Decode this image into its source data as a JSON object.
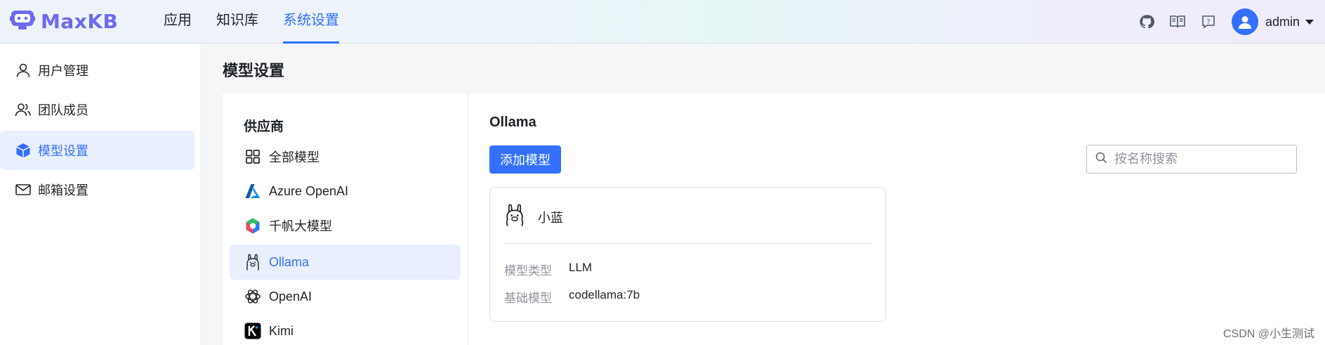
{
  "brand": {
    "name": "MaxKB",
    "color": "#6e6af0"
  },
  "topnav": [
    {
      "label": "应用",
      "active": false
    },
    {
      "label": "知识库",
      "active": false
    },
    {
      "label": "系统设置",
      "active": true
    }
  ],
  "header_right": {
    "icons": [
      "github-icon",
      "docs-book-icon",
      "help-icon"
    ],
    "user": "admin"
  },
  "sidebar": {
    "items": [
      {
        "label": "用户管理",
        "icon": "user-icon",
        "active": false
      },
      {
        "label": "团队成员",
        "icon": "team-icon",
        "active": false
      },
      {
        "label": "模型设置",
        "icon": "cube-icon",
        "active": true
      },
      {
        "label": "邮箱设置",
        "icon": "mail-icon",
        "active": false
      }
    ]
  },
  "page": {
    "title": "模型设置"
  },
  "providers": {
    "title": "供应商",
    "items": [
      {
        "label": "全部模型",
        "icon": "grid-icon",
        "active": false
      },
      {
        "label": "Azure OpenAI",
        "icon": "azure-icon",
        "active": false
      },
      {
        "label": "千帆大模型",
        "icon": "qianfan-icon",
        "active": false
      },
      {
        "label": "Ollama",
        "icon": "ollama-icon",
        "active": true
      },
      {
        "label": "OpenAI",
        "icon": "openai-icon",
        "active": false
      },
      {
        "label": "Kimi",
        "icon": "kimi-icon",
        "active": false
      }
    ]
  },
  "detail": {
    "title": "Ollama",
    "add_button": "添加模型",
    "search_placeholder": "按名称搜索"
  },
  "model_card": {
    "name": "小蓝",
    "rows": [
      {
        "key": "模型类型",
        "value": "LLM"
      },
      {
        "key": "基础模型",
        "value": "codellama:7b"
      }
    ]
  },
  "watermark": "CSDN @小生测试",
  "colors": {
    "accent": "#3370ff",
    "active_bg": "#e9effd"
  }
}
